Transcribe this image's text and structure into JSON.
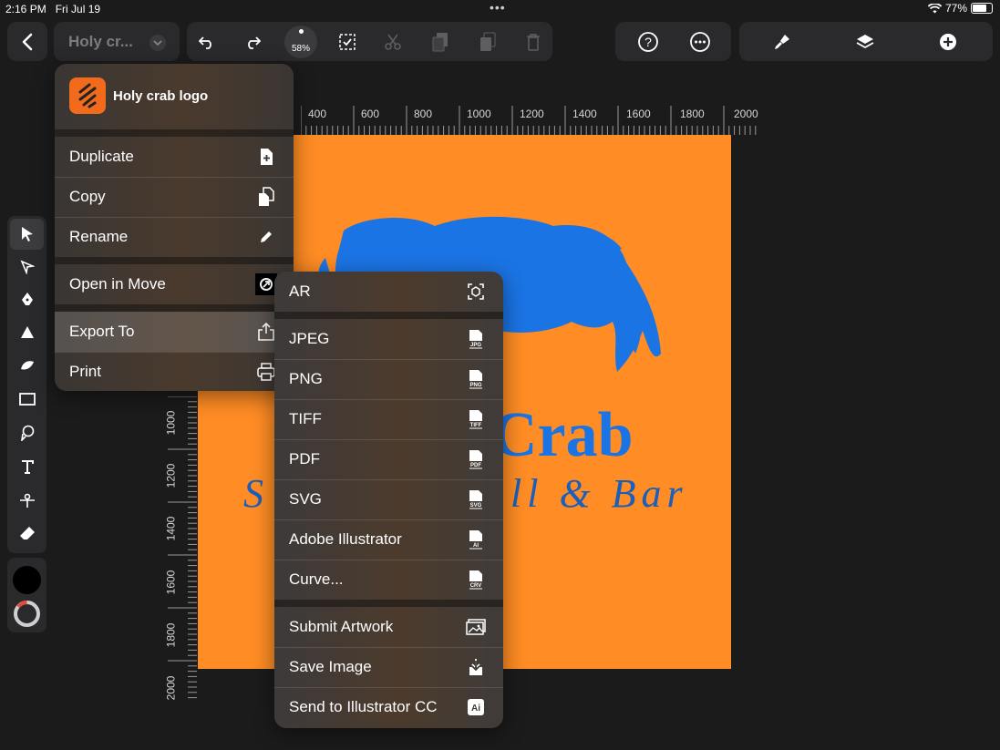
{
  "status_bar": {
    "time": "2:16 PM",
    "date": "Fri Jul 19",
    "battery": "77%"
  },
  "toolbar": {
    "document_title": "Holy cr...",
    "zoom": "58%",
    "icons": [
      "back-icon",
      "chevron-down-icon",
      "undo-icon",
      "redo-icon",
      "select-all-icon",
      "scissors-icon",
      "duplicate-icon",
      "paste-icon",
      "trash-icon",
      "help-icon",
      "more-icon",
      "brush-icon",
      "layers-icon",
      "add-icon"
    ]
  },
  "ruler": {
    "top": [
      "400",
      "600",
      "800",
      "1000",
      "1200",
      "1400",
      "1600",
      "1800",
      "2000"
    ],
    "left": [
      "1000",
      "1200",
      "1400",
      "1600",
      "1800",
      "2000"
    ]
  },
  "artboard": {
    "background": "#ff8c24",
    "text_line1": "Crab",
    "text_line2_left": "S",
    "text_line2_right": "ll & Bar",
    "text_color": "#1b74e4"
  },
  "file_menu": {
    "header": "Holy crab logo",
    "items": [
      {
        "label": "Duplicate",
        "icon": "duplicate-icon"
      },
      {
        "label": "Copy",
        "icon": "copy-icon"
      },
      {
        "label": "Rename",
        "icon": "pencil-icon"
      },
      {
        "label": "Open in Move",
        "icon": "move-app-icon"
      },
      {
        "label": "Export To",
        "icon": "share-icon"
      },
      {
        "label": "Print",
        "icon": "printer-icon"
      }
    ]
  },
  "export_menu": {
    "items": [
      {
        "label": "AR",
        "icon": "ar-icon"
      },
      {
        "label": "JPEG",
        "badge": "JPG"
      },
      {
        "label": "PNG",
        "badge": "PNG"
      },
      {
        "label": "TIFF",
        "badge": "TIFF"
      },
      {
        "label": "PDF",
        "badge": "PDF"
      },
      {
        "label": "SVG",
        "badge": "SVG"
      },
      {
        "label": "Adobe Illustrator",
        "badge": "AI"
      },
      {
        "label": "Curve...",
        "badge": "CRV"
      },
      {
        "label": "Submit Artwork",
        "icon": "image-icon"
      },
      {
        "label": "Save Image",
        "icon": "download-icon"
      },
      {
        "label": "Send to Illustrator CC",
        "badge": "Ai"
      }
    ]
  },
  "colors": {
    "accent": "#ff8c24",
    "primary_stroke": "#000000",
    "app_icon": "#f26a1b"
  }
}
